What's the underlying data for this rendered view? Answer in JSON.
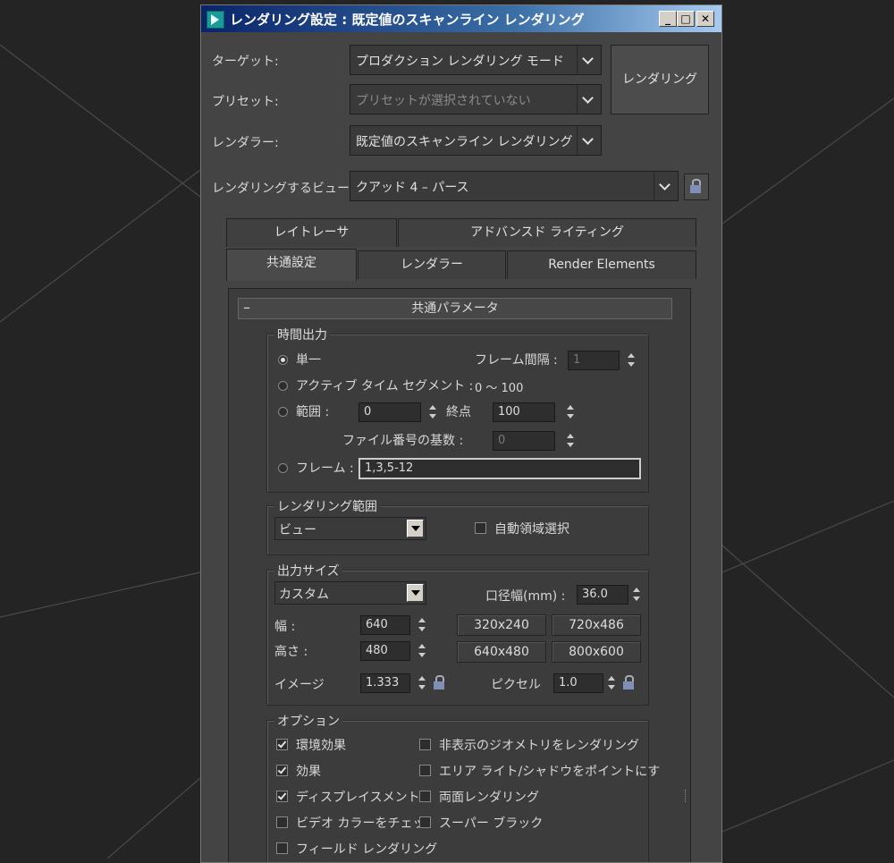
{
  "window": {
    "title": "レンダリング設定 : 既定値のスキャンライン レンダリング"
  },
  "top": {
    "target_label": "ターゲット:",
    "target_value": "プロダクション レンダリング モード",
    "preset_label": "プリセット:",
    "preset_value": "プリセットが選択されていない",
    "renderer_label": "レンダラー:",
    "renderer_value": "既定値のスキャンライン レンダリング",
    "view_label": "レンダリングするビュー:",
    "view_value": "クアッド 4 – パース",
    "render_button": "レンダリング"
  },
  "tabs": {
    "row1": [
      "レイトレーサ",
      "アドバンスド ライティング"
    ],
    "row2": [
      "共通設定",
      "レンダラー",
      "Render Elements"
    ]
  },
  "rollout": {
    "title": "共通パラメータ",
    "collapse": "–"
  },
  "time_output": {
    "title": "時間出力",
    "single": "単一",
    "frame_interval_label": "フレーム間隔 :",
    "frame_interval_value": "1",
    "active_segment": "アクティブ タイム セグメント :",
    "active_segment_range": "0 〜 100",
    "range": "範囲 :",
    "range_start": "0",
    "range_end_label": "終点",
    "range_end": "100",
    "file_number_base_label": "ファイル番号の基数 :",
    "file_number_base": "0",
    "frames": "フレーム :",
    "frames_value": "1,3,5-12",
    "selected": "single"
  },
  "render_area": {
    "title": "レンダリング範囲",
    "area_value": "ビュー",
    "auto_region_label": "自動領域選択",
    "auto_region_checked": false
  },
  "output_size": {
    "title": "出力サイズ",
    "preset_value": "カスタム",
    "aperture_label": "口径幅(mm) :",
    "aperture_value": "36.0",
    "width_label": "幅 :",
    "width_value": "640",
    "height_label": "高さ :",
    "height_value": "480",
    "image_label": "イメージ",
    "image_aspect": "1.333",
    "pixel_label": "ピクセル",
    "pixel_aspect": "1.0",
    "presets": [
      "320x240",
      "720x486",
      "640x480",
      "800x600"
    ]
  },
  "options": {
    "title": "オプション",
    "items": [
      {
        "label": "環境効果",
        "checked": true
      },
      {
        "label": "非表示のジオメトリをレンダリング",
        "checked": false
      },
      {
        "label": "効果",
        "checked": true
      },
      {
        "label": "エリア ライト/シャドウをポイントにす",
        "checked": false
      },
      {
        "label": "ディスプレイスメント",
        "checked": true
      },
      {
        "label": "両面レンダリング",
        "checked": false
      },
      {
        "label": "ビデオ カラーをチェッ",
        "checked": false
      },
      {
        "label": "スーパー ブラック",
        "checked": false
      },
      {
        "label": "フィールド レンダリング",
        "checked": false
      }
    ]
  },
  "colors": {
    "background": "#242424",
    "panel": "#444444",
    "titlebar_start": "#0a246a",
    "titlebar_end": "#a6caf0"
  }
}
